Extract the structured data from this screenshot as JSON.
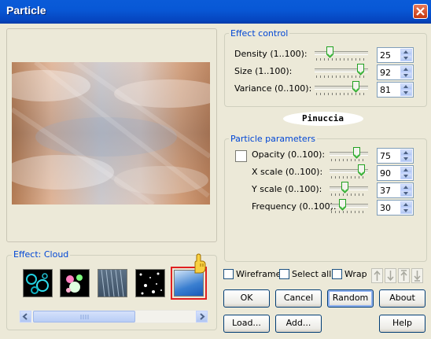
{
  "window": {
    "title": "Particle"
  },
  "watermark": {
    "text": "Pinuccia"
  },
  "effect_control": {
    "legend": "Effect control",
    "rows": [
      {
        "label": "Density (1..100):",
        "value": "25",
        "level": 0.25
      },
      {
        "label": "Size (1..100):",
        "value": "92",
        "level": 0.92
      },
      {
        "label": "Variance (0..100):",
        "value": "81",
        "level": 0.81
      }
    ]
  },
  "particle_parameters": {
    "legend": "Particle parameters",
    "rows": [
      {
        "label": "Opacity (0..100):",
        "value": "75",
        "level": 0.75
      },
      {
        "label": "X scale (0..100):",
        "value": "90",
        "level": 0.9
      },
      {
        "label": "Y scale (0..100):",
        "value": "37",
        "level": 0.37
      },
      {
        "label": "Frequency (0..100):",
        "value": "30",
        "level": 0.3
      }
    ]
  },
  "effect_presets": {
    "legend": "Effect: Cloud",
    "thumbnails": [
      "bubbles",
      "glow-orbs",
      "rain",
      "stars",
      "cloud"
    ],
    "selected": "cloud"
  },
  "options": {
    "wireframe_label": "Wireframe",
    "select_all_label": "Select all",
    "wrap_label": "Wrap"
  },
  "buttons": {
    "ok": "OK",
    "cancel": "Cancel",
    "random": "Random",
    "about": "About",
    "load": "Load...",
    "add": "Add...",
    "help": "Help"
  },
  "colors": {
    "title_bar": "#0a5bd8",
    "legend_text": "#0046d5",
    "selection_border": "#e02020",
    "dialog_bg": "#ece9d8"
  }
}
